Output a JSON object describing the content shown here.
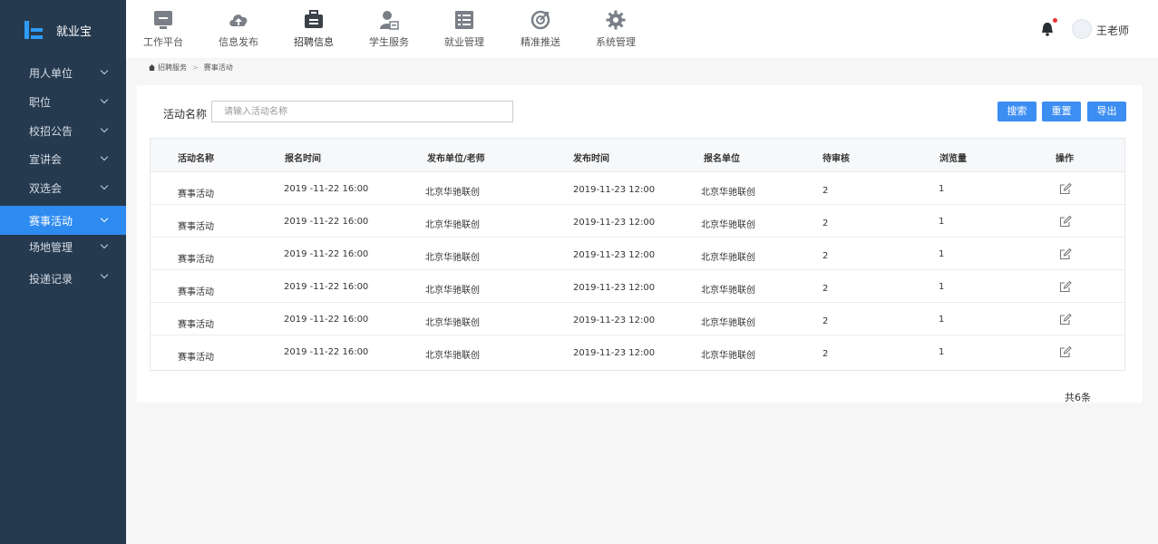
{
  "app": {
    "title": "就业宝"
  },
  "sidebar": {
    "items": [
      {
        "label": "用人单位"
      },
      {
        "label": "职位"
      },
      {
        "label": "校招公告"
      },
      {
        "label": "宣讲会"
      },
      {
        "label": "双选会"
      },
      {
        "label": "赛事活动",
        "active": true
      },
      {
        "label": "场地管理"
      },
      {
        "label": "投递记录"
      }
    ]
  },
  "topnav": {
    "items": [
      {
        "label": "工作平台",
        "icon": "monitor-icon"
      },
      {
        "label": "信息发布",
        "icon": "cloud-upload-icon"
      },
      {
        "label": "招聘信息",
        "icon": "briefcase-icon"
      },
      {
        "label": "学生服务",
        "icon": "student-icon"
      },
      {
        "label": "就业管理",
        "icon": "list-icon"
      },
      {
        "label": "精准推送",
        "icon": "target-icon"
      },
      {
        "label": "系统管理",
        "icon": "gear-icon"
      }
    ]
  },
  "user": {
    "name": "王老师"
  },
  "breadcrumb": {
    "items": [
      "招聘服务",
      "赛事活动"
    ]
  },
  "search": {
    "label": "活动名称",
    "placeholder": "请输入活动名称",
    "value": ""
  },
  "buttons": {
    "search": "搜索",
    "reset": "重置",
    "export": "导出"
  },
  "table": {
    "columns": [
      "活动名称",
      "报名时间",
      "发布单位/老师",
      "发布时间",
      "报名单位",
      "待审核",
      "浏览量",
      "操作"
    ],
    "rows": [
      [
        "赛事活动",
        "2019 -11-22 16:00",
        "北京华驰联创",
        "2019-11-23 12:00",
        "北京华驰联创",
        "2",
        "1"
      ],
      [
        "赛事活动",
        "2019 -11-22 16:00",
        "北京华驰联创",
        "2019-11-23 12:00",
        "北京华驰联创",
        "2",
        "1"
      ],
      [
        "赛事活动",
        "2019 -11-22 16:00",
        "北京华驰联创",
        "2019-11-23 12:00",
        "北京华驰联创",
        "2",
        "1"
      ],
      [
        "赛事活动",
        "2019 -11-22 16:00",
        "北京华驰联创",
        "2019-11-23 12:00",
        "北京华驰联创",
        "2",
        "1"
      ],
      [
        "赛事活动",
        "2019 -11-22 16:00",
        "北京华驰联创",
        "2019-11-23 12:00",
        "北京华驰联创",
        "2",
        "1"
      ],
      [
        "赛事活动",
        "2019 -11-22 16:00",
        "北京华驰联创",
        "2019-11-23 12:00",
        "北京华驰联创",
        "2",
        "1"
      ]
    ]
  },
  "pagination": {
    "total_text": "共6条"
  },
  "colors": {
    "sidebar_bg": "#263a4f",
    "accent": "#2e8bf0",
    "button": "#3d8ef2",
    "badge": "#e33"
  }
}
